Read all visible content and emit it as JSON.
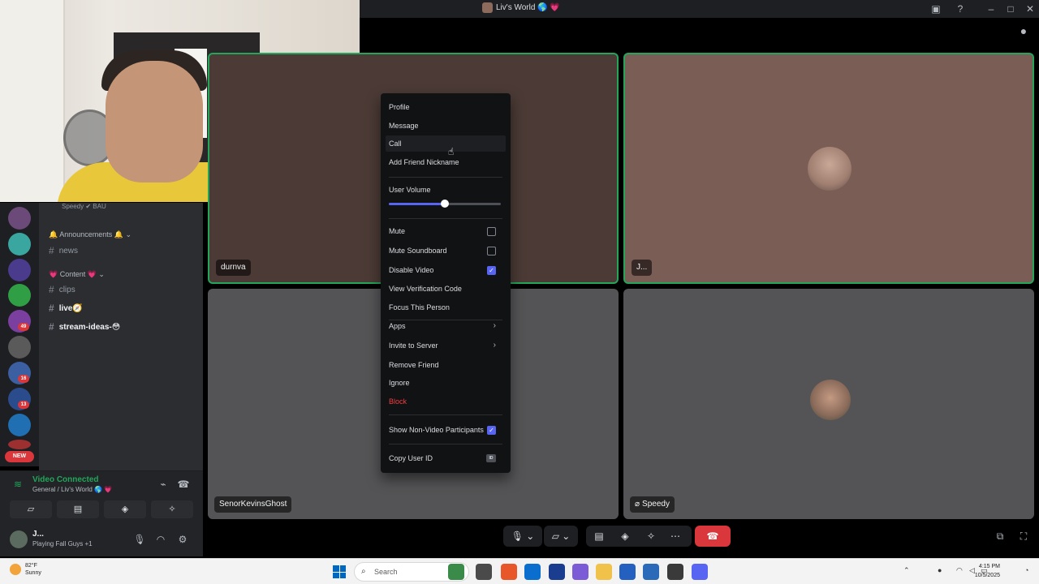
{
  "window": {
    "title": "Liv's World 🌎 💗"
  },
  "channels": {
    "speedy_row": "Speedy  ✔ BAU",
    "categories": [
      {
        "label": "🔔 Announcements 🔔 ⌄"
      },
      {
        "label": "💗 Content 💗 ⌄"
      }
    ],
    "items": [
      {
        "name": "news"
      },
      {
        "name": "clips"
      },
      {
        "name": "live🧭"
      },
      {
        "name": "stream-ideas-😳"
      }
    ]
  },
  "rail": {
    "new_badge": "NEW",
    "badges": [
      "49",
      "16",
      "13"
    ]
  },
  "voice": {
    "status": "Video Connected",
    "location": "General / Liv's World 🌎 💗"
  },
  "user": {
    "name": "J...",
    "status": "Playing Fall Guys +1"
  },
  "tiles": [
    {
      "label": "durnva"
    },
    {
      "label": "J..."
    },
    {
      "label": "SenorKevinsGhost"
    },
    {
      "label": "Speedy"
    }
  ],
  "context_menu": {
    "items_top": [
      "Profile",
      "Message",
      "Call",
      "Add Friend Nickname"
    ],
    "volume_label": "User Volume",
    "volume_fraction": 0.5,
    "mute": "Mute",
    "mute_soundboard": "Mute Soundboard",
    "disable_video": "Disable Video",
    "view_verification": "View Verification Code",
    "focus_person": "Focus This Person",
    "apps": "Apps",
    "invite": "Invite to Server",
    "remove_friend": "Remove Friend",
    "ignore": "Ignore",
    "block": "Block",
    "show_non_video": "Show Non-Video Participants",
    "copy_user_id": "Copy User ID",
    "id_badge": "ID",
    "checks": {
      "mute": false,
      "mute_soundboard": false,
      "disable_video": true,
      "show_non_video": true
    }
  },
  "taskbar": {
    "weather_temp": "82°F",
    "weather_desc": "Sunny",
    "search_placeholder": "Search",
    "time": "4:15 PM",
    "date": "10/5/2025"
  },
  "colors": {
    "speaking": "#23a55a",
    "accent": "#5865f2",
    "danger": "#f23f42",
    "end_call": "#da373c"
  }
}
